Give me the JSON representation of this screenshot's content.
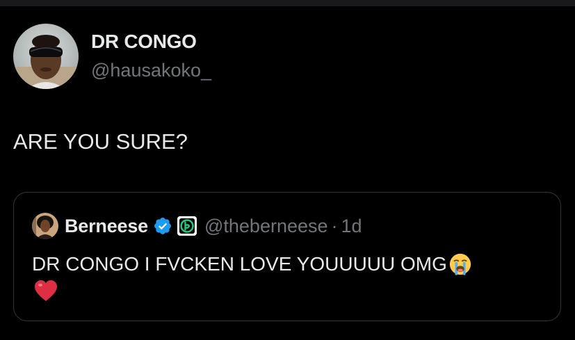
{
  "tweet": {
    "author": {
      "name": "DR CONGO",
      "handle": "@hausakoko_"
    },
    "text": "ARE YOU SURE?"
  },
  "quote": {
    "author": {
      "name": "Berneese",
      "handle": "@theberneese",
      "separator": "·",
      "time": "1d"
    },
    "text": "DR CONGO I FVCKEN LOVE YOUUUUU OMG",
    "emojis": [
      "loudly-crying-face-icon",
      "red-heart-icon"
    ]
  },
  "colors": {
    "background": "#000000",
    "primary_text": "#e7e9ea",
    "secondary_text": "#71767b",
    "border": "#333639",
    "verified_blue": "#1d9bf0",
    "affiliate_green": "#21c77a"
  }
}
